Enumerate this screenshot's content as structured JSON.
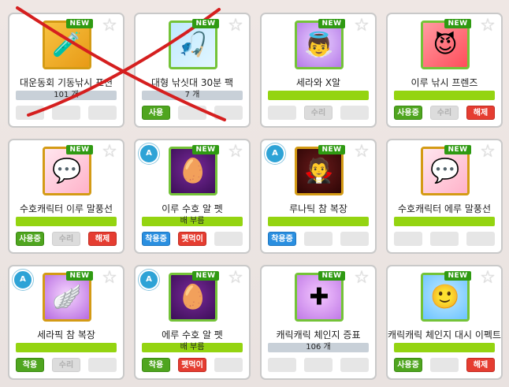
{
  "cards": [
    {
      "title": "대운동회 기동낚시 포션",
      "bar_text": "101 개",
      "bar": "gray",
      "new": "NEW",
      "buttons": [
        "",
        "",
        ""
      ],
      "star": "☆",
      "icon": "potion-icon"
    },
    {
      "title": "대형 낚싯대 30분 팩",
      "bar_text": "7 개",
      "bar": "gray",
      "new": "NEW",
      "buttons": [
        "사용",
        "",
        ""
      ],
      "star": "☆",
      "icon": "fishing-pack-icon"
    },
    {
      "title": "세라와 X알",
      "bar_text": "",
      "bar": "green",
      "new": "NEW",
      "buttons": [
        "",
        "수리",
        ""
      ],
      "star": "☆",
      "icon": "sera-icon"
    },
    {
      "title": "이루 낚시 프렌즈",
      "bar_text": "",
      "bar": "green",
      "new": "NEW",
      "buttons": [
        "사용중",
        "수리",
        "해제"
      ],
      "star": "☆",
      "icon": "iru-friends-icon"
    },
    {
      "title": "수호캐릭터 이루 말풍선",
      "bar_text": "",
      "bar": "green",
      "new": "NEW",
      "buttons": [
        "사용중",
        "수리",
        "해제"
      ],
      "star": "☆",
      "icon": "bubble-icon"
    },
    {
      "title": "이루 수호 알 펫",
      "bar_text": "배 부름",
      "bar": "green",
      "new": "NEW",
      "buttons": [
        "착용중",
        "펫먹이",
        ""
      ],
      "star": "☆",
      "badge": "A",
      "icon": "egg-icon"
    },
    {
      "title": "루나틱 참 복장",
      "bar_text": "",
      "bar": "green",
      "new": "NEW",
      "buttons": [
        "착용중",
        "",
        ""
      ],
      "star": "☆",
      "badge": "A",
      "icon": "costume-icon"
    },
    {
      "title": "수호캐릭터 에루 말풍선",
      "bar_text": "",
      "bar": "green",
      "new": "NEW",
      "buttons": [
        "",
        "",
        ""
      ],
      "star": "☆",
      "icon": "bubble-icon"
    },
    {
      "title": "세라픽 참 복장",
      "bar_text": "",
      "bar": "green",
      "new": "NEW",
      "buttons": [
        "착용",
        "수리",
        ""
      ],
      "star": "☆",
      "badge": "A",
      "icon": "costume-icon"
    },
    {
      "title": "에루 수호 알 펫",
      "bar_text": "배 부름",
      "bar": "green",
      "new": "NEW",
      "buttons": [
        "착용",
        "펫먹이",
        ""
      ],
      "star": "☆",
      "badge": "A",
      "icon": "egg-icon"
    },
    {
      "title": "캐릭캐릭 체인지 증표",
      "bar_text": "106 개",
      "bar": "gray",
      "new": "NEW",
      "buttons": [
        "",
        "",
        ""
      ],
      "star": "☆",
      "icon": "cross-icon"
    },
    {
      "title": "캐릭캐릭 체인지 대시 이펙트",
      "bar_text": "",
      "bar": "green",
      "new": "NEW",
      "buttons": [
        "사용중",
        "",
        "해제"
      ],
      "star": "☆",
      "icon": "dash-effect-icon"
    }
  ]
}
